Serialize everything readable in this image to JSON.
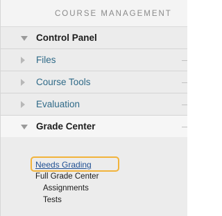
{
  "header": {
    "title": "COURSE MANAGEMENT"
  },
  "menu": {
    "control_panel": {
      "label": "Control Panel"
    },
    "files": {
      "label": "Files"
    },
    "course_tools": {
      "label": "Course Tools"
    },
    "evaluation": {
      "label": "Evaluation"
    },
    "grade_center": {
      "label": "Grade Center",
      "items": [
        "Needs Grading",
        "Full Grade Center",
        "Assignments",
        "Tests"
      ]
    }
  },
  "colors": {
    "highlight": "#f2b33a",
    "link": "#2f6a88",
    "active_link": "#1f4f93"
  }
}
